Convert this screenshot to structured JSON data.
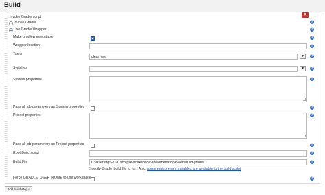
{
  "section": {
    "title": "Build"
  },
  "step": {
    "title": "Invoke Gradle script",
    "delete_label": "X",
    "options": {
      "invoke_gradle": "Invoke Gradle",
      "use_wrapper": "Use Gradle Wrapper"
    },
    "make_executable_label": "Make gradlew executable",
    "wrapper_location_label": "Wrapper location",
    "wrapper_location_value": "",
    "tasks_label": "Tasks",
    "tasks_value": "clean test",
    "switches_label": "Switches",
    "switches_value": "",
    "system_properties_label": "System properties",
    "pass_system_label": "Pass all job parameters as System properties",
    "project_properties_label": "Project properties",
    "pass_project_label": "Pass all job parameters as Project properties",
    "root_script_label": "Root Build script",
    "root_script_value": "",
    "build_file_label": "Build File",
    "build_file_value": "C:\\Users\\rgs-2181\\eclipse-workspace\\api\\automationeveen\\build.gradle",
    "build_file_hint_prefix": "Specify Gradle build file to run. Also, ",
    "build_file_hint_link": "some environment variables are available to the build script",
    "force_home_label": "Force GRADLE_USER_HOME to use workspace",
    "expand_icon": "down-arrow"
  },
  "add_step": {
    "label": "Add build step ▾"
  },
  "colors": {
    "help": "#3a6fc4",
    "delete": "#c9302c",
    "link": "#2056a8"
  }
}
